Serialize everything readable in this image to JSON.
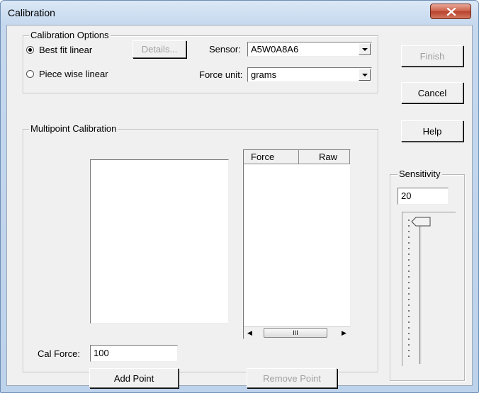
{
  "window": {
    "title": "Calibration"
  },
  "calibration_options": {
    "legend": "Calibration Options",
    "best_fit_label": "Best fit linear",
    "piece_wise_label": "Piece wise linear",
    "selected": "best_fit",
    "details_label": "Details...",
    "sensor_label": "Sensor:",
    "sensor_value": "A5W0A8A6",
    "force_unit_label": "Force unit:",
    "force_unit_value": "grams"
  },
  "side_buttons": {
    "finish": "Finish",
    "cancel": "Cancel",
    "help": "Help"
  },
  "multipoint": {
    "legend": "Multipoint Calibration",
    "columns": [
      "Force",
      "Raw"
    ],
    "rows": [],
    "scroll_grip": "III",
    "cal_force_label": "Cal Force:",
    "cal_force_value": "100",
    "add_point_label": "Add Point",
    "remove_point_label": "Remove Point"
  },
  "sensitivity": {
    "legend": "Sensitivity",
    "value": "20",
    "level": 0.0
  }
}
